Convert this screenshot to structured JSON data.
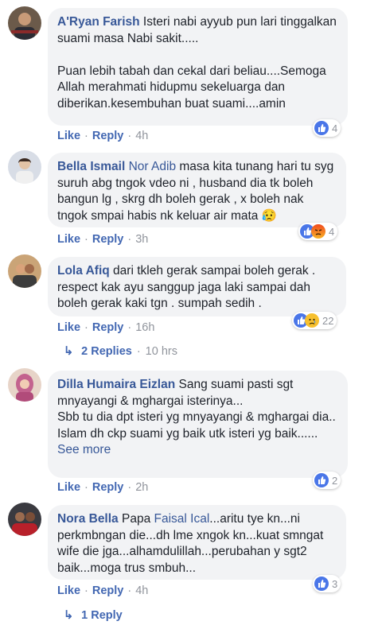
{
  "comments": [
    {
      "author": "A'Ryan Farish",
      "mention": "",
      "text": "Isteri nabi ayyub pun lari tinggalkan suami masa Nabi sakit.....\n\nPuan lebih tabah dan cekal dari beliau....Semoga Allah merahmati hidupmu sekeluarga dan diberikan.kesembuhan buat suami....amin",
      "like": "Like",
      "reply": "Reply",
      "time": "4h",
      "reaction_count": "4",
      "reactions": [
        "like-icon"
      ]
    },
    {
      "author": "Bella Ismail",
      "mention": "Nor Adib",
      "text": "masa kita tunang hari tu syg suruh abg tngok vdeo ni , husband dia tk boleh bangun lg , skrg dh boleh gerak , x boleh nak tngok smpai habis nk keluar air mata",
      "emoji": "😥",
      "like": "Like",
      "reply": "Reply",
      "time": "3h",
      "reaction_count": "4",
      "reactions": [
        "like-icon",
        "angry-icon"
      ]
    },
    {
      "author": "Lola Afiq",
      "mention": "",
      "text": "dari tkleh gerak sampai boleh gerak . respect kak ayu sanggup jaga laki sampai dah boleh gerak kaki tgn . sumpah sedih .",
      "like": "Like",
      "reply": "Reply",
      "time": "16h",
      "reaction_count": "22",
      "reactions": [
        "like-icon",
        "sad-icon"
      ],
      "replies_label": "2 Replies",
      "replies_time": "10 hrs"
    },
    {
      "author": "Dilla Humaira Eizlan",
      "mention": "",
      "text": "Sang suami pasti sgt mnyayangi & mghargai isterinya...\nSbb tu dia dpt isteri yg mnyayangi & mghargai dia..\nIslam dh ckp suami yg baik utk isteri yg baik......",
      "see_more": "See more",
      "like": "Like",
      "reply": "Reply",
      "time": "2h",
      "reaction_count": "2",
      "reactions": [
        "like-icon"
      ]
    },
    {
      "author": "Nora Bella",
      "mention": "",
      "prefix": "Papa",
      "mention2": "Faisal Ical",
      "text": "...aritu tye kn...ni perkmbngan die...dh lme xngok kn...kuat smngat wife die jga...alhamdulillah...perubahan y sgt2 baik...moga trus smbuh...",
      "like": "Like",
      "reply": "Reply",
      "time": "4h",
      "reaction_count": "3",
      "reactions": [
        "like-icon"
      ],
      "replies_label": "1 Reply"
    }
  ],
  "separator": "·",
  "reply_arrow": "↳",
  "colors": {
    "link": "#385898",
    "bubble": "#f2f3f5",
    "like_blue": "#4a76e8",
    "meta": "#90949c"
  }
}
